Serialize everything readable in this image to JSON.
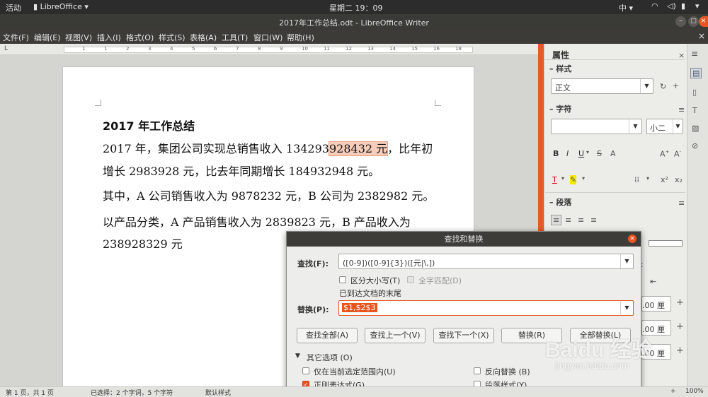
{
  "topbar": {
    "activities": "活动",
    "app": "LibreOffice",
    "clock": "星期二 19：09",
    "ime": "中"
  },
  "window": {
    "title": "2017年工作总结.odt - LibreOffice Writer"
  },
  "menu": [
    "文件(F)",
    "编辑(E)",
    "视图(V)",
    "插入(I)",
    "格式(O)",
    "样式(S)",
    "表格(A)",
    "工具(T)",
    "窗口(W)",
    "帮助(H)"
  ],
  "ruler": {
    "ticks": [
      "1",
      "1",
      "2",
      "3",
      "4",
      "5",
      "6",
      "7",
      "8",
      "9",
      "10",
      "11",
      "12",
      "13",
      "14",
      "15",
      "16",
      "18"
    ]
  },
  "document": {
    "title": "2017 年工作总结",
    "line1_pre": "2017 年，集团公司实现总销售收入 134293",
    "line1_hl": "928432 元",
    "line1_post": "，比年初",
    "line2": "增长 2983928 元，比去年同期增长 184932948 元。",
    "line3": "其中，A 公司销售收入为 9878232 元，B 公司为 2382982 元。",
    "line4": "以产品分类，A 产品销售收入为 2839823 元，B 产品收入为",
    "line5": "238928329 元"
  },
  "sidebar": {
    "title": "属性",
    "styles_label": "样式",
    "style_value": "正文",
    "char_label": "字符",
    "size_value": "小二",
    "para_label": "段落",
    "partial": [
      ":",
      ".00 厘",
      ".00 厘",
      ".00 厘"
    ]
  },
  "dialog": {
    "title": "查找和替换",
    "find_label": "查找(F):",
    "find_value": "([0-9])([0-9]{3})([元|\\,])",
    "match_case": "区分大小写(T)",
    "whole_words": "全字匹配(D)",
    "status": "已到达文档的末尾",
    "replace_label": "替换(P):",
    "replace_value": "$1,$2$3",
    "buttons": [
      "查找全部(A)",
      "查找上一个(V)",
      "查找下一个(X)",
      "替换(R)",
      "全部替换(L)"
    ],
    "other_options": "其它选项 (O)",
    "opt_selection": "仅在当前选定范围内(U)",
    "opt_backwards": "反向替换 (B)",
    "opt_regex": "正则表达式(G)",
    "opt_parastyles": "段落样式(Y)"
  },
  "statusbar": {
    "page": "第 1 页，共 1 页",
    "selection": "已选择：2 个字词，5 个字符",
    "style": "默认样式",
    "zoom": "100%"
  },
  "watermark": {
    "brand": "Baidu 经验",
    "url": "jingyan.baidu.com"
  },
  "colors": {
    "accent": "#e95420",
    "highlight": "#f6cdbb",
    "dark": "#2c2c2c"
  }
}
